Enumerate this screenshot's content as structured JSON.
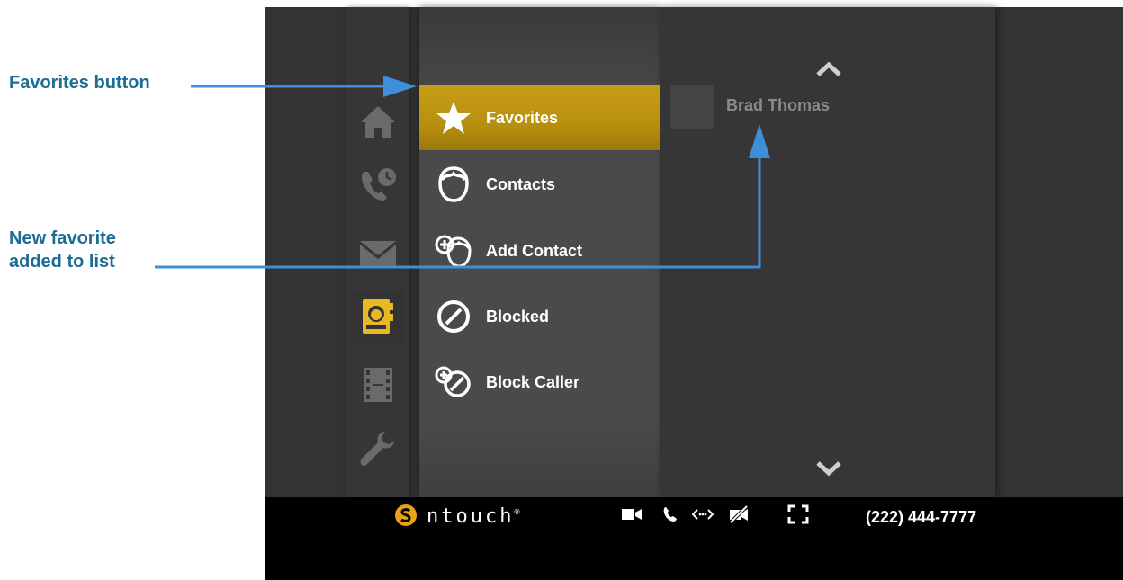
{
  "callouts": {
    "favorites_button": "Favorites button",
    "new_favorite_line1": "New favorite",
    "new_favorite_line2": "added to list"
  },
  "sidebar": {
    "items": [
      {
        "icon": "home-icon"
      },
      {
        "icon": "call-history-icon"
      },
      {
        "icon": "mail-icon"
      },
      {
        "icon": "contacts-book-icon",
        "active": true
      },
      {
        "icon": "film-icon"
      },
      {
        "icon": "wrench-icon"
      }
    ]
  },
  "menu": {
    "items": [
      {
        "label": "Favorites",
        "icon": "star-icon",
        "selected": true
      },
      {
        "label": "Contacts",
        "icon": "contact-face-icon"
      },
      {
        "label": "Add Contact",
        "icon": "add-contact-icon"
      },
      {
        "label": "Blocked",
        "icon": "blocked-icon"
      },
      {
        "label": "Block Caller",
        "icon": "block-caller-icon"
      }
    ]
  },
  "favorites_list": {
    "items": [
      {
        "name": "Brad Thomas"
      }
    ]
  },
  "status_bar": {
    "brand": "ntouch",
    "brand_mark": "®",
    "phone_number": "(222) 444-7777",
    "icons": [
      "video-icon",
      "phone-icon",
      "connection-icon",
      "video-privacy-icon",
      "fullscreen-icon"
    ]
  },
  "colors": {
    "callout": "#1d6c93",
    "arrow": "#3c8fd8",
    "accent": "#e8b923",
    "selected_bg": "#b8900f"
  }
}
